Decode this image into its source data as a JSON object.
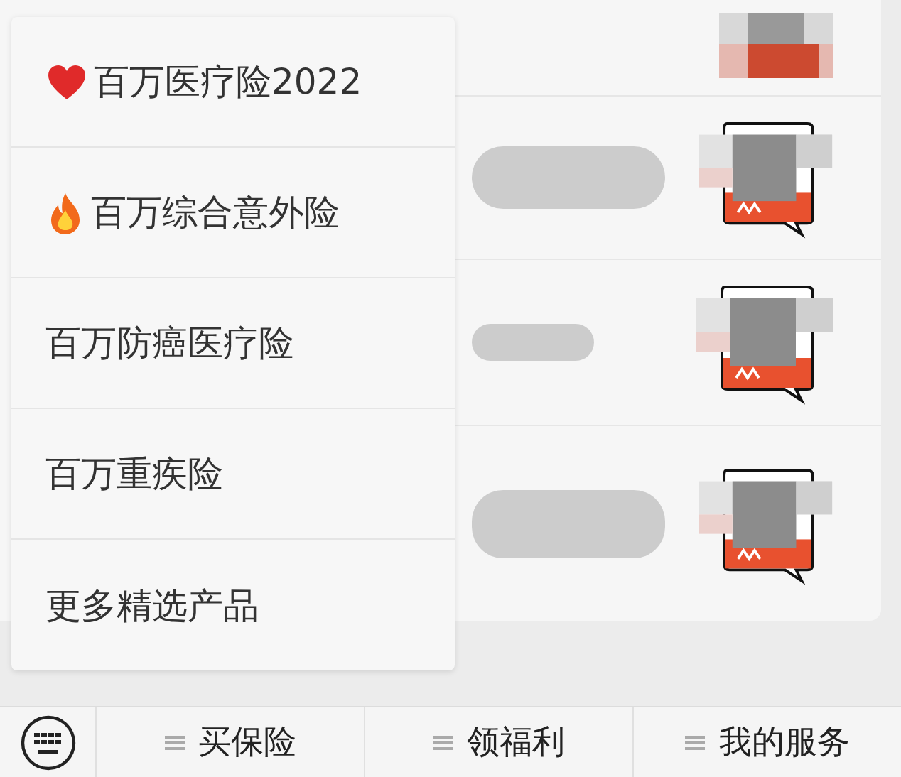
{
  "popup_menu": {
    "items": [
      {
        "label": "百万医疗险2022",
        "kind": "heart"
      },
      {
        "label": "百万综合意外险",
        "kind": "fire"
      },
      {
        "label": "百万防癌医疗险",
        "kind": "plain"
      },
      {
        "label": "百万重疾险",
        "kind": "plain"
      },
      {
        "label": "更多精选产品",
        "kind": "plain"
      }
    ]
  },
  "bottom_menu": {
    "items": [
      {
        "label": "买保险"
      },
      {
        "label": "领福利"
      },
      {
        "label": "我的服务"
      }
    ]
  }
}
